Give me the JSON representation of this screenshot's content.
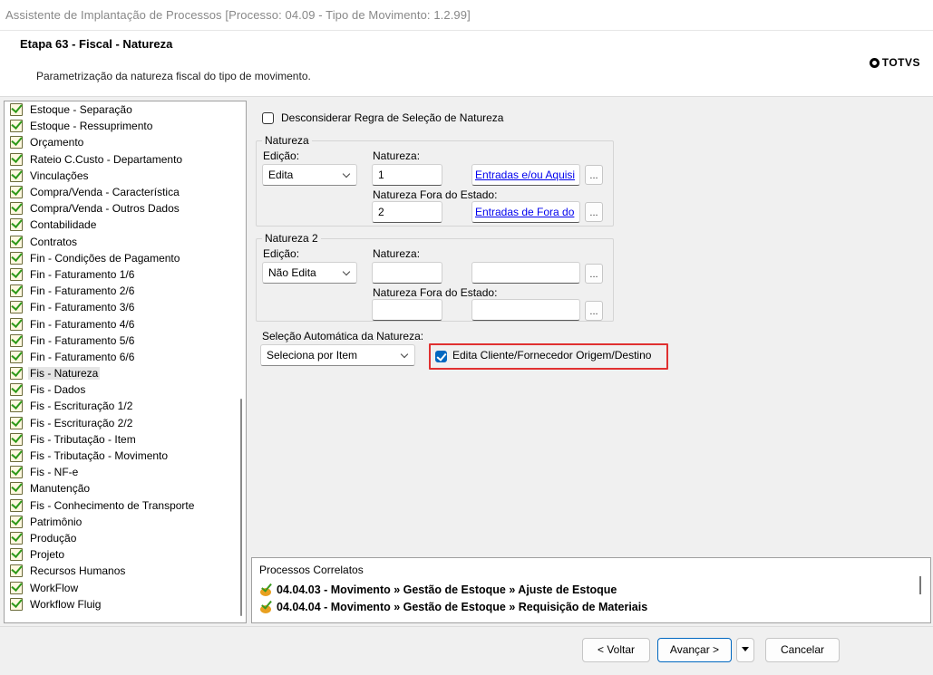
{
  "window": {
    "title": "Assistente de Implantação de Processos [Processo: 04.09 - Tipo de Movimento: 1.2.99]"
  },
  "header": {
    "step_title": "Etapa 63 - Fiscal - Natureza",
    "description": "Parametrização da natureza fiscal do tipo de movimento.",
    "logo_text": "TOTVS"
  },
  "tree": {
    "selected_index": 16,
    "items": [
      "Estoque - Separação",
      "Estoque - Ressuprimento",
      "Orçamento",
      "Rateio C.Custo - Departamento",
      "Vinculações",
      "Compra/Venda - Característica",
      "Compra/Venda - Outros Dados",
      "Contabilidade",
      "Contratos",
      "Fin - Condições de Pagamento",
      "Fin - Faturamento 1/6",
      "Fin - Faturamento 2/6",
      "Fin - Faturamento 3/6",
      "Fin - Faturamento 4/6",
      "Fin - Faturamento 5/6",
      "Fin - Faturamento 6/6",
      "Fis - Natureza",
      "Fis - Dados",
      "Fis - Escrituração 1/2",
      "Fis - Escrituração 2/2",
      "Fis - Tributação - Item",
      "Fis - Tributação - Movimento",
      "Fis - NF-e",
      "Manutenção",
      "Fis - Conhecimento de Transporte",
      "Patrimônio",
      "Produção",
      "Projeto",
      "Recursos Humanos",
      "WorkFlow",
      "Workflow Fluig"
    ]
  },
  "form": {
    "disregard_rule_label": "Desconsiderar Regra de Seleção de Natureza",
    "disregard_rule_checked": false,
    "natureza": {
      "group_title": "Natureza",
      "edicao_label": "Edição:",
      "edicao_value": "Edita",
      "natureza_label": "Natureza:",
      "natureza_value": "1",
      "natureza_link": "Entradas e/ou Aquisi",
      "fora_label": "Natureza Fora do Estado:",
      "fora_value": "2",
      "fora_link": "Entradas de Fora do",
      "lookup_label": "..."
    },
    "natureza2": {
      "group_title": "Natureza 2",
      "edicao_label": "Edição:",
      "edicao_value": "Não Edita",
      "natureza_label": "Natureza:",
      "natureza_value": "",
      "natureza_desc": "",
      "fora_label": "Natureza Fora do Estado:",
      "fora_value": "",
      "fora_desc": "",
      "lookup_label": "..."
    },
    "auto_selection_label": "Seleção Automática da Natureza:",
    "auto_selection_value": "Seleciona por Item",
    "edit_client_label": "Edita Cliente/Fornecedor Origem/Destino",
    "edit_client_checked": true
  },
  "related": {
    "title": "Processos Correlatos",
    "items": [
      "04.04.03 - Movimento » Gestão de Estoque » Ajuste de Estoque",
      "04.04.04 - Movimento » Gestão de Estoque » Requisição de Materiais"
    ]
  },
  "footer": {
    "back_label": "< Voltar",
    "next_label": "Avançar >",
    "cancel_label": "Cancelar"
  },
  "colors": {
    "accent": "#0067c0",
    "highlight": "#e03030",
    "link": "#0000ee"
  }
}
